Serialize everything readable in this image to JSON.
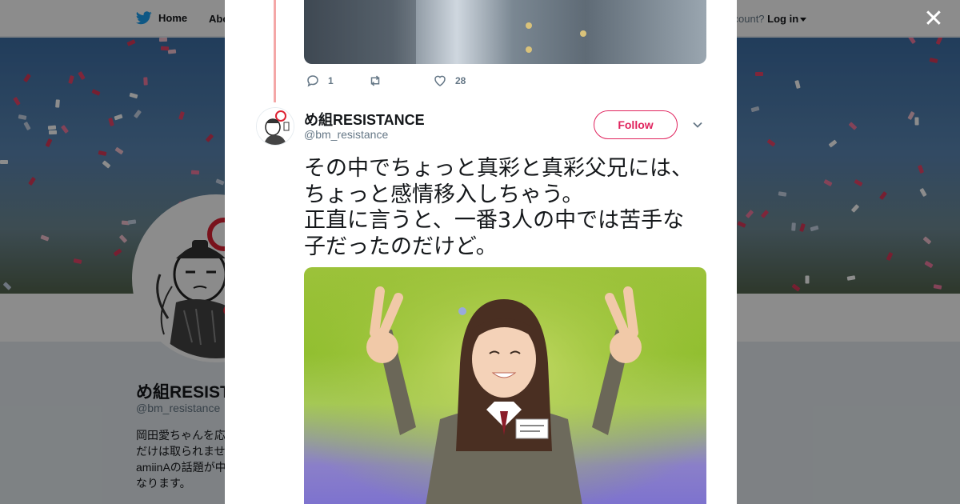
{
  "topbar": {
    "home_label": "Home",
    "about_label": "Abo",
    "account_prompt": "ccount?",
    "login_label": "Log in"
  },
  "profile": {
    "name": "め組RESIST",
    "handle": "@bm_resistance",
    "bio_lines": [
      "岡田愛ちゃんを応",
      "だけは取られませ",
      "amiinAの話題が中",
      "なります。"
    ]
  },
  "modal": {
    "prev_tweet": {
      "reply_count": "1",
      "retweet_count": "",
      "like_count": "28"
    },
    "tweet": {
      "author_name": "め組RESISTANCE",
      "author_handle": "@bm_resistance",
      "follow_label": "Follow",
      "text_lines": [
        "その中でちょっと真彩と真彩父兄には、",
        "ちょっと感情移入しちゃう。",
        "正直に言うと、一番3人の中では苦手な",
        "子だったのだけど。"
      ]
    }
  },
  "icons": [
    "twitter-bird-icon",
    "close-icon",
    "reply-icon",
    "retweet-icon",
    "like-icon",
    "chevron-down-icon"
  ],
  "colors": {
    "accent": "#e0245e",
    "twitter_blue": "#1da1f2",
    "thread_line": "#f4a7a7",
    "text": "#14171a",
    "muted": "#657786"
  }
}
